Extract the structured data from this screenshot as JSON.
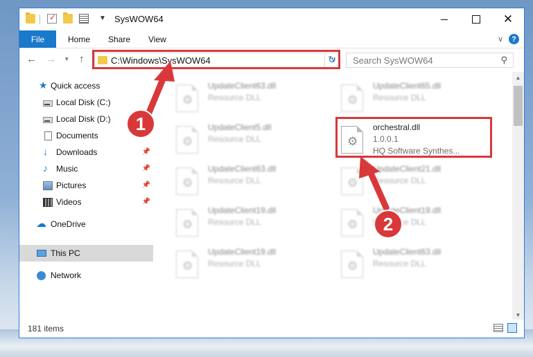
{
  "window": {
    "title": "SysWOW64"
  },
  "ribbon": {
    "tabs": [
      "File",
      "Home",
      "Share",
      "View"
    ],
    "help": "?"
  },
  "navigation": {
    "back": "←",
    "forward": "→",
    "recent": "▾",
    "up": "↑",
    "address": "C:\\Windows\\SysWOW64",
    "search_placeholder": "Search SysWOW64"
  },
  "sidebar": {
    "items": [
      {
        "label": "Quick access",
        "icon": "star-icon"
      },
      {
        "label": "Local Disk (C:)",
        "icon": "disk-icon"
      },
      {
        "label": "Local Disk (D:)",
        "icon": "disk-icon"
      },
      {
        "label": "Documents",
        "icon": "document-icon"
      },
      {
        "label": "Downloads",
        "icon": "download-icon"
      },
      {
        "label": "Music",
        "icon": "music-icon"
      },
      {
        "label": "Pictures",
        "icon": "pictures-icon"
      },
      {
        "label": "Videos",
        "icon": "videos-icon"
      },
      {
        "label": "OneDrive",
        "icon": "cloud-icon"
      },
      {
        "label": "This PC",
        "icon": "computer-icon"
      },
      {
        "label": "Network",
        "icon": "network-icon"
      }
    ],
    "selected": "This PC"
  },
  "files": [
    {
      "name": "UpdateClient63.dll",
      "type": "Resource DLL"
    },
    {
      "name": "UpdateClient65.dll",
      "type": "Resource DLL"
    },
    {
      "name": "UpdateClient5.dll",
      "type": "Resource DLL"
    },
    {
      "name": "orchestral.dll",
      "version": "1.0.0.1",
      "company": "HQ Software Synthes..."
    },
    {
      "name": "UpdateClient63.dll",
      "type": "Resource DLL"
    },
    {
      "name": "UpdateClient21.dll",
      "type": "Resource DLL"
    },
    {
      "name": "UpdateClient19.dll",
      "type": "Resource DLL"
    },
    {
      "name": "UpdateClient19.dll",
      "type": "Resource DLL"
    },
    {
      "name": "UpdateClient19.dll",
      "type": "Resource DLL"
    },
    {
      "name": "UpdateClient63.dll",
      "type": "Resource DLL"
    }
  ],
  "status": {
    "item_count": "181 items"
  },
  "annotations": {
    "marker1": "1",
    "marker2": "2",
    "color": "#d9383a"
  }
}
